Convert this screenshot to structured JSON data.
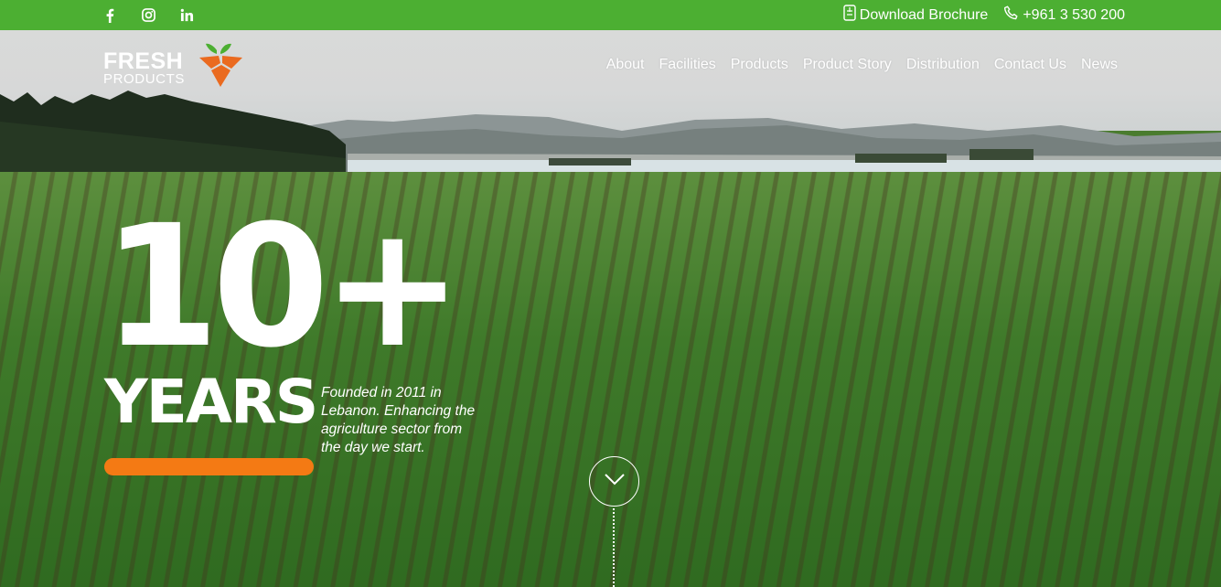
{
  "topbar": {
    "social": [
      {
        "icon": "facebook-icon"
      },
      {
        "icon": "instagram-icon"
      },
      {
        "icon": "linkedin-icon"
      }
    ],
    "download_label": "Download Brochure",
    "phone": "+961 3 530 200"
  },
  "logo": {
    "line1": "FRESH",
    "line2": "PRODUCTS"
  },
  "nav": {
    "items": [
      "About",
      "Facilities",
      "Products",
      "Product Story",
      "Distribution",
      "Contact Us",
      "News"
    ]
  },
  "hero": {
    "number": "10+",
    "unit": "YEARS",
    "description": "Founded in 2011 in Lebanon. Enhancing the agriculture sector from the day we start."
  },
  "colors": {
    "topbar": "#4caf32",
    "accent_orange": "#f47a14",
    "logo_orange": "#ea6a1f",
    "logo_green": "#4caf32"
  }
}
